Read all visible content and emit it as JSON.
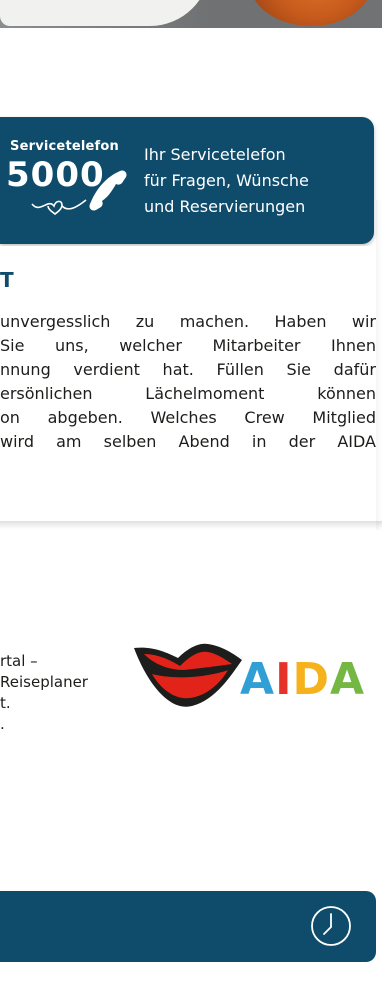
{
  "service": {
    "label": "Servicetelefon",
    "number": "5000",
    "desc_lines": [
      "Ihr Servicetelefon",
      "für Fragen, Wünsche",
      "und Reservierungen"
    ]
  },
  "smile": {
    "heading": "T",
    "lines": [
      "unvergesslich zu machen. Haben wir",
      " Sie uns, welcher Mitarbeiter Ihnen",
      "nnung verdient hat. Füllen Sie dafür",
      "ersönlichen Lächelmoment können",
      "on abgeben. Welches Crew Mitglied",
      "wird am selben Abend in der AIDA"
    ]
  },
  "portal": {
    "lines": [
      "rtal –",
      "Reiseplaner",
      "t.",
      "."
    ]
  },
  "logo": {
    "letters": [
      "A",
      "I",
      "D",
      "A"
    ],
    "colors": [
      "#2f9fd6",
      "#e6332a",
      "#f5b21d",
      "#74b843"
    ]
  },
  "icons": [
    "phone-icon",
    "heart-icon",
    "clock-icon",
    "aida-lips-icon"
  ],
  "colors": {
    "accent": "#0f4c6b",
    "lips": "#e2231a"
  }
}
